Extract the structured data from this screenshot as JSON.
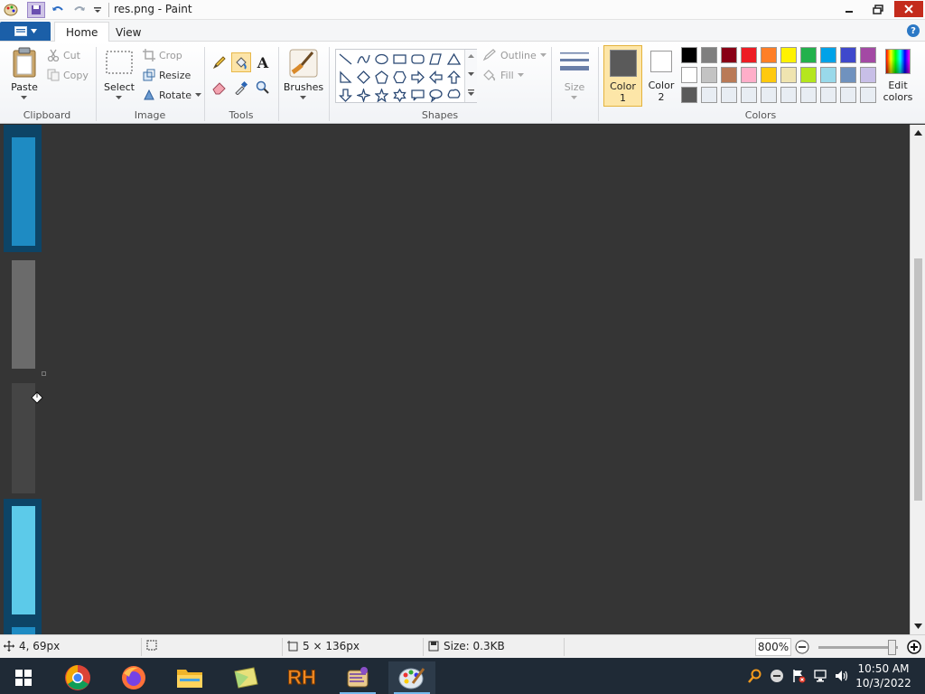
{
  "title_bar": {
    "title": "res.png - Paint"
  },
  "tabs": {
    "home": "Home",
    "view": "View"
  },
  "clipboard": {
    "paste": "Paste",
    "cut": "Cut",
    "copy": "Copy",
    "group": "Clipboard"
  },
  "image": {
    "select": "Select",
    "crop": "Crop",
    "resize": "Resize",
    "rotate": "Rotate",
    "group": "Image"
  },
  "tools": {
    "group": "Tools",
    "text_tool_glyph": "A"
  },
  "brushes": {
    "label": "Brushes"
  },
  "shapes": {
    "outline": "Outline",
    "fill": "Fill",
    "group": "Shapes"
  },
  "size": {
    "label": "Size"
  },
  "colors": {
    "color1_line1": "Color",
    "color1_line2": "1",
    "color2_line1": "Color",
    "color2_line2": "2",
    "edit_line1": "Edit",
    "edit_line2": "colors",
    "group": "Colors",
    "color1_value": "#5a5a5a",
    "color2_value": "#ffffff",
    "palette": [
      "#000000",
      "#7f7f7f",
      "#880015",
      "#ed1c24",
      "#ff7f27",
      "#fff200",
      "#22b14c",
      "#00a2e8",
      "#3f48cc",
      "#a349a4",
      "#ffffff",
      "#c3c3c3",
      "#b97a57",
      "#ffaec9",
      "#ffc90e",
      "#efe4b0",
      "#b5e61d",
      "#99d9ea",
      "#7092be",
      "#c8bfe7",
      "#5a5a5a",
      "#e8edf3",
      "#e8edf3",
      "#e8edf3",
      "#e8edf3",
      "#e8edf3",
      "#e8edf3",
      "#e8edf3",
      "#e8edf3",
      "#e8edf3"
    ]
  },
  "canvas": {
    "pixel_colors": [
      "#0d4466",
      "#1e8bc3",
      "#6b6b6b",
      "#454545",
      "#5ccae9"
    ]
  },
  "status": {
    "cursor_pos": "4, 69px",
    "image_size": "5 × 136px",
    "file_size": "Size: 0.3KB",
    "zoom": "800%"
  },
  "taskbar": {
    "apps": [
      "start-icon",
      "chrome-icon",
      "firefox-icon",
      "file-explorer-icon",
      "sticky-notes-icon",
      "resource-hacker-icon",
      "scroll-app-icon",
      "paint-icon"
    ],
    "rh_label": "RH",
    "clock_time": "10:50 AM",
    "clock_date": "10/3/2022"
  }
}
